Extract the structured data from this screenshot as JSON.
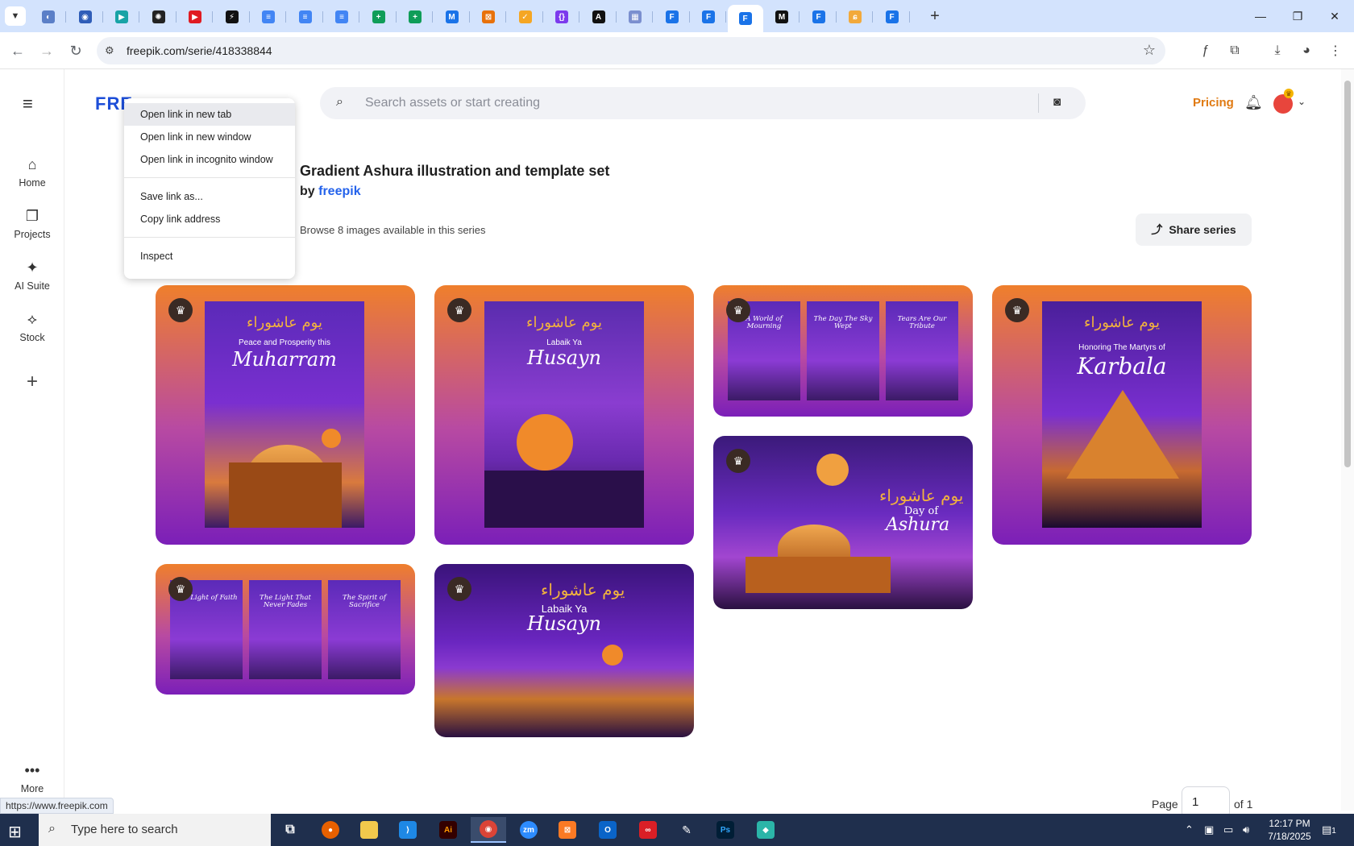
{
  "browser": {
    "url": "freepik.com/serie/418338844",
    "tabs": [
      {
        "name": "tab-1",
        "color": "#5b7fc7",
        "glyph": "◐"
      },
      {
        "name": "tab-2",
        "color": "#2f5db8",
        "glyph": "◉"
      },
      {
        "name": "tab-3",
        "color": "#18a3a6",
        "glyph": "▶"
      },
      {
        "name": "tab-4",
        "color": "#222222",
        "glyph": "✺"
      },
      {
        "name": "tab-5",
        "color": "#e01b22",
        "glyph": "▶"
      },
      {
        "name": "tab-6",
        "color": "#111111",
        "glyph": "⚡"
      },
      {
        "name": "tab-7",
        "color": "#4285f4",
        "glyph": "≡"
      },
      {
        "name": "tab-8",
        "color": "#4285f4",
        "glyph": "≡"
      },
      {
        "name": "tab-9",
        "color": "#4285f4",
        "glyph": "≡"
      },
      {
        "name": "tab-10",
        "color": "#0f9d58",
        "glyph": "+"
      },
      {
        "name": "tab-11",
        "color": "#0f9d58",
        "glyph": "+"
      },
      {
        "name": "tab-12",
        "color": "#1a73e8",
        "glyph": "M"
      },
      {
        "name": "tab-13",
        "color": "#e8710a",
        "glyph": "⊠"
      },
      {
        "name": "tab-14",
        "color": "#f5a623",
        "glyph": "✓"
      },
      {
        "name": "tab-15",
        "color": "#7c3aed",
        "glyph": "{}"
      },
      {
        "name": "tab-16",
        "color": "#111111",
        "glyph": "A"
      },
      {
        "name": "tab-17",
        "color": "#7b8fcf",
        "glyph": "▦"
      },
      {
        "name": "tab-18",
        "color": "#1a73e8",
        "glyph": "F"
      },
      {
        "name": "tab-19",
        "color": "#1a73e8",
        "glyph": "F"
      },
      {
        "name": "tab-20",
        "color": "#1a73e8",
        "glyph": "F"
      },
      {
        "name": "tab-21",
        "color": "#111111",
        "glyph": "M"
      },
      {
        "name": "tab-22",
        "color": "#1a73e8",
        "glyph": "F"
      },
      {
        "name": "tab-23",
        "color": "#f2a93b",
        "glyph": "ɕ"
      },
      {
        "name": "tab-24",
        "color": "#1a73e8",
        "glyph": "F"
      }
    ]
  },
  "site": {
    "logo": "FRE",
    "search_placeholder": "Search assets or start creating",
    "pricing": "Pricing",
    "nav": [
      {
        "label": "Home",
        "icon": "home-icon",
        "glyph": "⌂"
      },
      {
        "label": "Projects",
        "icon": "projects-icon",
        "glyph": "❐"
      },
      {
        "label": "AI Suite",
        "icon": "ai-suite-icon",
        "glyph": "✦"
      },
      {
        "label": "Stock",
        "icon": "stock-icon",
        "glyph": "⟡"
      }
    ],
    "more": "More"
  },
  "series": {
    "title": "Gradient Ashura illustration and template set",
    "by": "by",
    "author": "freepik",
    "browse": "Browse 8 images available in this series",
    "share": "Share series"
  },
  "cards": {
    "c1": {
      "sub": "Peace and Prosperity this",
      "big": "Muharram"
    },
    "c2": {
      "sub": "Labaik Ya",
      "big": "Husayn"
    },
    "c3": {
      "t1": "A World of Mourning",
      "t2": "The Day The Sky Wept",
      "t3": "Tears Are Our Tribute"
    },
    "c4": {
      "sub": "Honoring The Martyrs of",
      "big": "Karbala"
    },
    "c5": {
      "sub": "Day of",
      "big": "Ashura"
    },
    "c6": {
      "t1": "The Light of Faith",
      "t2": "The Light That Never Fades",
      "t3": "The Spirit of Sacrifice"
    },
    "c7": {
      "sub": "Labaik Ya",
      "big": "Husayn"
    },
    "arabic": "يوم عاشوراء"
  },
  "context_menu": {
    "items": [
      "Open link in new tab",
      "Open link in new window",
      "Open link in incognito window"
    ],
    "items2": [
      "Save link as...",
      "Copy link address"
    ],
    "items3": [
      "Inspect"
    ]
  },
  "status_url": "https://www.freepik.com",
  "pagination": {
    "page_label": "Page",
    "page": "1",
    "of": "of 1"
  },
  "taskbar": {
    "search": "Type here to search",
    "time": "12:17 PM",
    "date": "7/18/2025",
    "notif": "1"
  }
}
